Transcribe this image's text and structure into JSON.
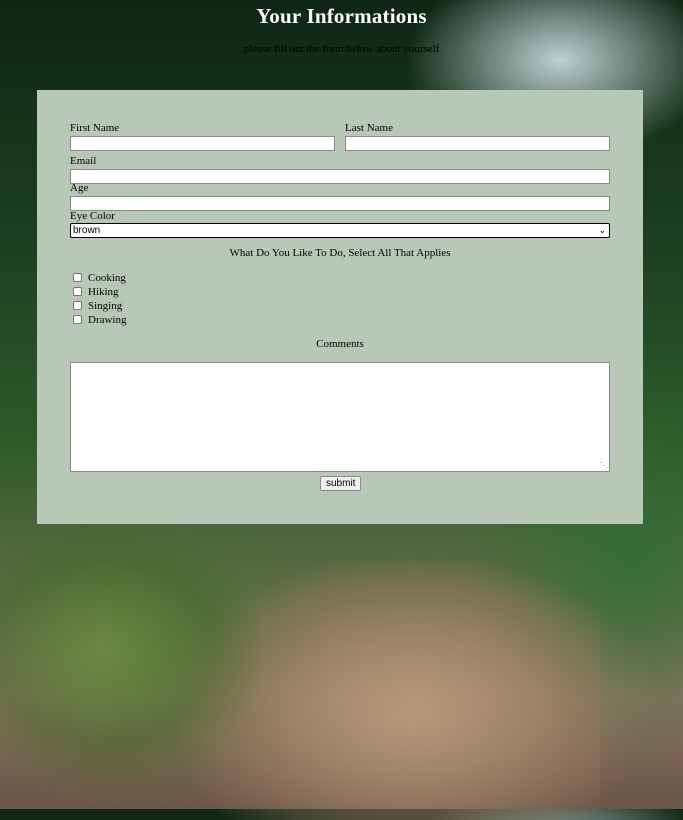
{
  "header": {
    "title": "Your Informations",
    "subtitle": "please fill out the form below about yourself"
  },
  "form": {
    "first_name": {
      "label": "First Name",
      "value": ""
    },
    "last_name": {
      "label": "Last Name",
      "value": ""
    },
    "email": {
      "label": "Email",
      "value": ""
    },
    "age": {
      "label": "Age",
      "value": ""
    },
    "eye_color": {
      "label": "Eye Color",
      "selected": "brown"
    },
    "activities": {
      "heading": "What Do You Like To Do, Select All That Applies",
      "options": [
        {
          "label": "Cooking",
          "checked": false
        },
        {
          "label": "Hiking",
          "checked": false
        },
        {
          "label": "Singing",
          "checked": false
        },
        {
          "label": "Drawing",
          "checked": false
        }
      ]
    },
    "comments": {
      "label": "Comments",
      "value": ""
    },
    "submit_label": "submit"
  },
  "colors": {
    "panel": "#b7c9b6",
    "title_text": "#ffffff"
  }
}
